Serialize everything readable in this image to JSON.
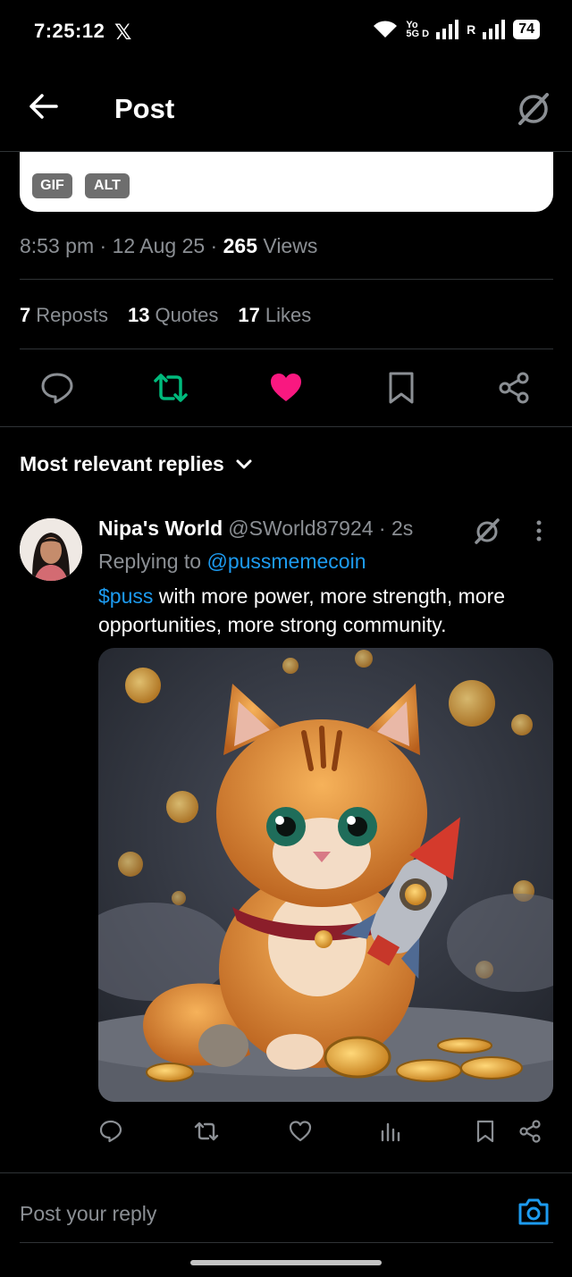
{
  "status_bar": {
    "time": "7:25:12",
    "app_icon": "x-logo",
    "net_top": "Yo",
    "net_bottom": "5G D",
    "roaming": "R",
    "battery": "74"
  },
  "header": {
    "title": "Post",
    "back_icon": "arrow-left-icon",
    "grok_icon": "grok-icon"
  },
  "media": {
    "gif_badge": "GIF",
    "alt_badge": "ALT"
  },
  "post_meta": {
    "time": "8:53 pm",
    "date": "12 Aug 25",
    "views_count": "265",
    "views_label": "Views"
  },
  "stats": {
    "reposts_count": "7",
    "reposts_label": "Reposts",
    "quotes_count": "13",
    "quotes_label": "Quotes",
    "likes_count": "17",
    "likes_label": "Likes"
  },
  "sort": {
    "label": "Most relevant replies"
  },
  "reply": {
    "author_name": "Nipa's World",
    "author_handle": "@SWorld87924",
    "age": "2s",
    "replying_prefix": "Replying to",
    "replying_handle": "@pussmemecoin",
    "cashtag": "$puss",
    "body": " with more power, more strength, more opportunities, more strong community."
  },
  "composer": {
    "placeholder": "Post your reply"
  },
  "colors": {
    "accent_blue": "#1d9bf0",
    "repost_green": "#00ba7c",
    "like_pink": "#f91880",
    "muted": "#8b8f94"
  }
}
